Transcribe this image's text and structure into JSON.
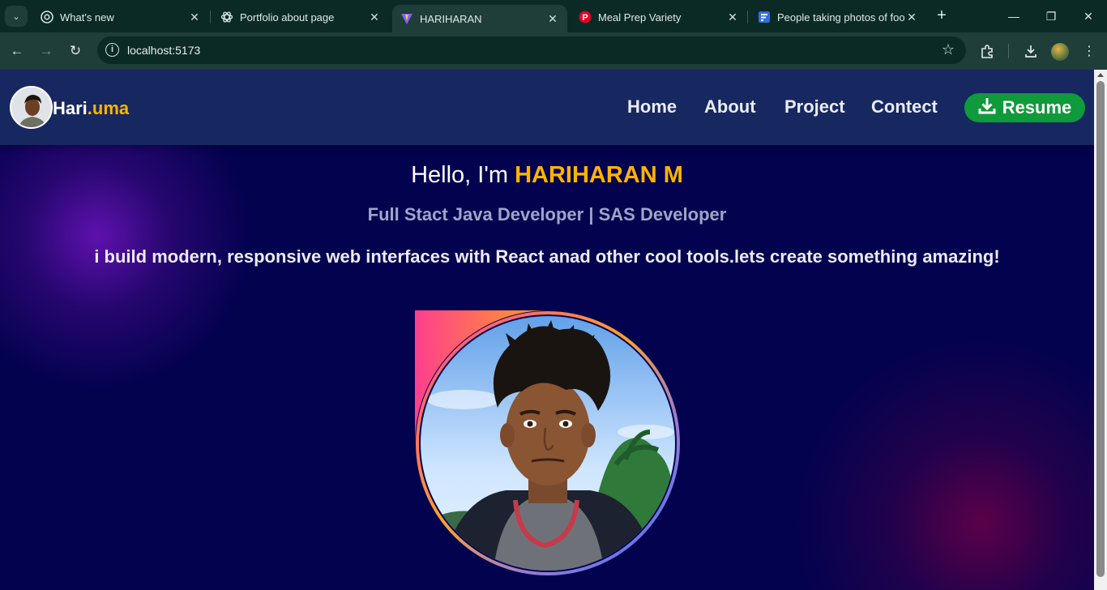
{
  "browser": {
    "tabs": [
      {
        "title": "What's new",
        "favicon": "chrome-icon"
      },
      {
        "title": "Portfolio about page",
        "favicon": "openai-icon"
      },
      {
        "title": "HARIHARAN",
        "favicon": "vite-icon"
      },
      {
        "title": "Meal Prep Variety",
        "favicon": "pinterest-icon"
      },
      {
        "title": "People taking photos of foo",
        "favicon": "doc-icon"
      }
    ],
    "url": "localhost:5173"
  },
  "site": {
    "logo_main": "Hari",
    "logo_accent": ".uma",
    "nav": [
      "Home",
      "About",
      "Project",
      "Contect"
    ],
    "resume_label": "Resume",
    "colors": {
      "header": "#172760",
      "accent": "#ffb400",
      "resume": "#0f9a3b",
      "background": "#03024f"
    }
  },
  "hero": {
    "greeting": "Hello, I'm",
    "name": "HARIHARAN M",
    "role": "Full Stact Java Developer | SAS Developer",
    "tagline": "i build modern, responsive web interfaces with React anad other cool tools.lets create something amazing!"
  }
}
